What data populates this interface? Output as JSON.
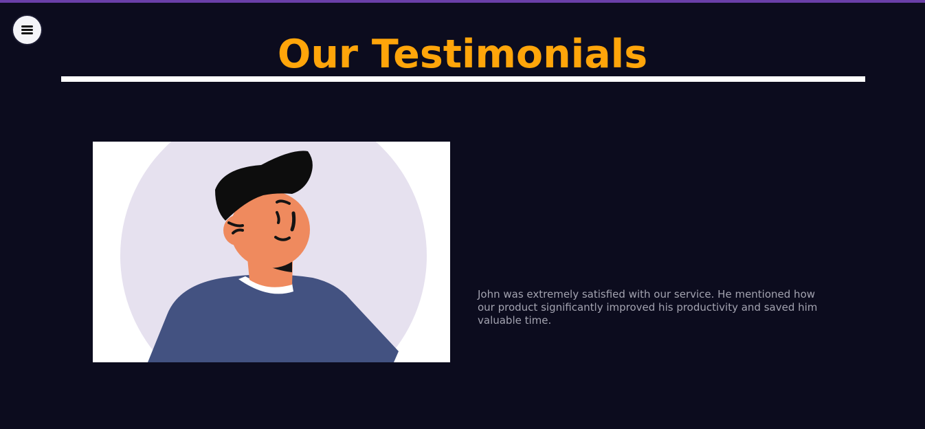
{
  "header": {
    "menu_icon": "hamburger-menu-icon",
    "title": "Our Testimonials"
  },
  "testimonial": {
    "avatar_icon": "person-avatar-illustration",
    "text": "John was extremely satisfied with our service. He mentioned how our product significantly improved his productivity and saved him valuable time."
  },
  "colors": {
    "background": "#0c0c1e",
    "top_strip": "#6a3fa8",
    "title": "#ffa50a",
    "underline": "#ffffff",
    "body_text": "#a3a3b0"
  }
}
